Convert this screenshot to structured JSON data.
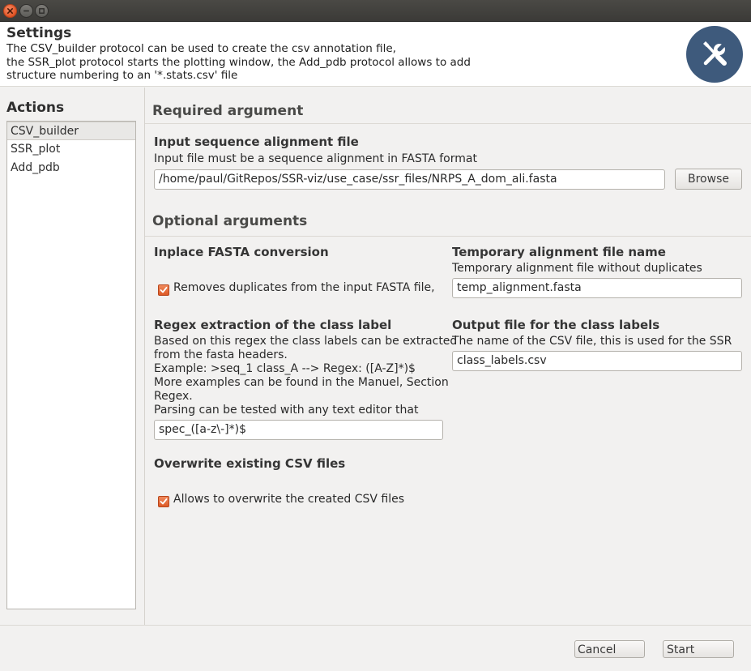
{
  "window": {
    "close_icon": "close-icon",
    "minimize_icon": "minimize-icon",
    "maximize_icon": "maximize-icon"
  },
  "header": {
    "title": "Settings",
    "description_lines": [
      "The CSV_builder protocol can be used to create the csv annotation file,",
      "the SSR_plot protocol starts the plotting window, the Add_pdb protocol allows to add",
      "structure numbering to an '*.stats.csv' file"
    ],
    "logo_icon": "tools-icon",
    "logo_color": "#3e5a7c"
  },
  "actions": {
    "title": "Actions",
    "items": [
      "CSV_builder",
      "SSR_plot",
      "Add_pdb"
    ],
    "selected": "CSV_builder"
  },
  "required": {
    "section_title": "Required argument",
    "input_file": {
      "title": "Input sequence alignment file",
      "description": "Input file must be a sequence alignment in FASTA format",
      "value": "/home/paul/GitRepos/SSR-viz/use_case/ssr_files/NRPS_A_dom_ali.fasta",
      "browse_label": "Browse"
    }
  },
  "optional": {
    "section_title": "Optional arguments",
    "inplace": {
      "title": "Inplace FASTA conversion",
      "checkbox_label": "Removes duplicates from the input FASTA file,",
      "checked": true
    },
    "temp_file": {
      "title": "Temporary alignment file name",
      "description": "Temporary alignment file without duplicates",
      "value": "temp_alignment.fasta"
    },
    "regex": {
      "title": "Regex extraction of the class label",
      "description_lines": [
        "Based on this regex the class labels can be extracted",
        "from the fasta headers.",
        "Example: >seq_1 class_A --> Regex: ([A-Z]*)$",
        "More examples can be found in the Manuel, Section",
        "Regex.",
        "Parsing can be tested with any text editor that"
      ],
      "value": "spec_([a-z\\-]*)$"
    },
    "output_labels": {
      "title": "Output file for the class labels",
      "description": "The name of the CSV file, this is used for the SSR",
      "value": "class_labels.csv"
    },
    "overwrite": {
      "title": "Overwrite existing CSV files",
      "checkbox_label": "Allows to overwrite the created CSV files",
      "checked": true
    }
  },
  "footer": {
    "cancel_label": "Cancel",
    "start_label": "Start"
  },
  "colors": {
    "accent_orange": "#e05526",
    "checkbox_orange": "#f08a5d",
    "titlebar": "#3b3a37"
  }
}
